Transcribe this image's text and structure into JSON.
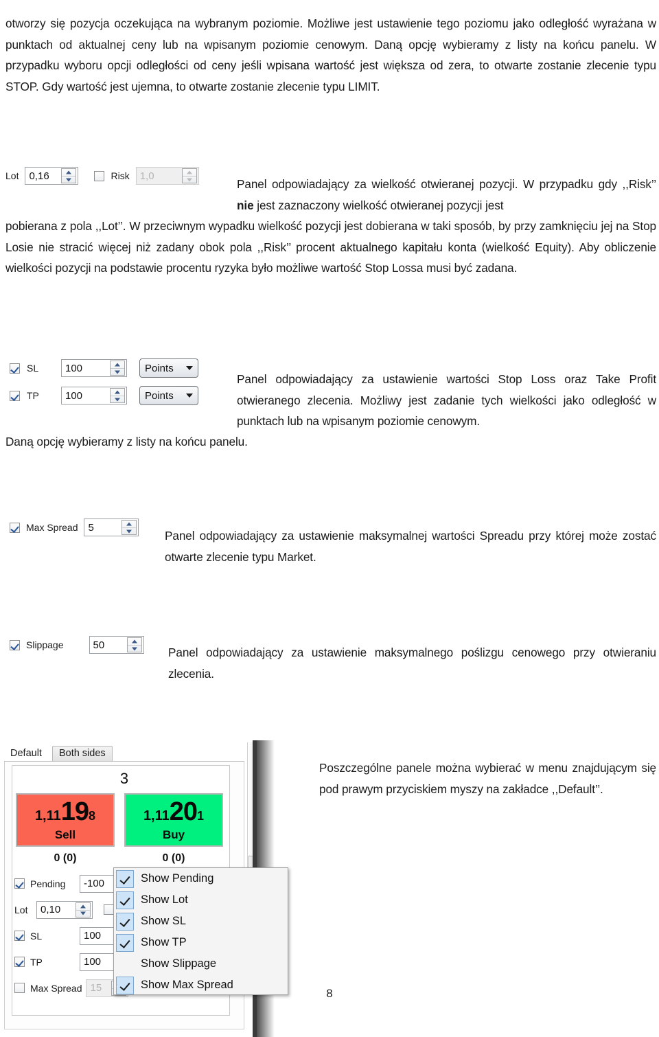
{
  "document": {
    "page_number": "8",
    "paragraphs": {
      "intro": "otworzy się pozycja oczekująca na wybranym poziomie. Możliwe jest ustawienie tego poziomu jako odległość wyrażana w punktach od aktualnej ceny lub na wpisanym poziomie cenowym.  Daną opcję wybieramy z listy na końcu panelu. W przypadku  wyboru opcji odległości od ceny jeśli wpisana wartość jest większa od zera, to otwarte zostanie zlecenie typu STOP. Gdy wartość jest ujemna, to otwarte zostanie zlecenie typu LIMIT.",
      "lot_part1_a": "Panel odpowiadający za wielkość otwieranej pozycji. W przypadku gdy ,,Risk’’ ",
      "lot_part1_bold": "nie",
      "lot_part1_b": " jest zaznaczony wielkość otwieranej   pozycji jest",
      "lot_part2": "pobierana z pola ,,Lot’’. W przeciwnym wypadku  wielkość pozycji jest dobierana w taki sposób, by przy zamknięciu jej na Stop Losie nie stracić więcej niż zadany obok pola ,,Risk’’ procent aktualnego kapitału konta (wielkość Equity). Aby obliczenie wielkości pozycji na podstawie procentu ryzyka było możliwe wartość Stop Lossa musi być zadana.",
      "sltp_part1": "Panel odpowiadający za ustawienie wartości Stop Loss oraz Take Profit otwieranego zlecenia. Możliwy jest zadanie tych wielkości jako odległość w punktach lub na wpisanym poziomie cenowym.",
      "sltp_part2": "Daną opcję wybieramy z listy na końcu panelu.",
      "max_spread": "Panel odpowiadający za ustawienie maksymalnej wartości Spreadu przy której może zostać otwarte zlecenie typu Market.",
      "slippage": " Panel odpowiadający za ustawienie maksymalnego poślizgu cenowego przy otwieraniu zlecenia.",
      "panel_menu": "Poszczególne panele można wybierać w menu znajdującym się pod prawym przyciskiem myszy na zakładce ,,Default’’."
    }
  },
  "widget_lot": {
    "lot_label": "Lot",
    "lot_value": "0,16",
    "risk_label": "Risk",
    "risk_value": "1,0",
    "risk_checked": false
  },
  "widget_sltp": {
    "rows": [
      {
        "label": "SL",
        "checked": true,
        "value": "100",
        "unit": "Points"
      },
      {
        "label": "TP",
        "checked": true,
        "value": "100",
        "unit": "Points"
      }
    ]
  },
  "widget_max_spread": {
    "label": "Max Spread",
    "checked": true,
    "value": "5"
  },
  "widget_slippage": {
    "label": "Slippage",
    "checked": true,
    "value": "50"
  },
  "widget_panel": {
    "tabs": [
      {
        "label": "Default",
        "active": true
      },
      {
        "label": "Both sides",
        "active": false
      }
    ],
    "spread": "3",
    "quotes": [
      {
        "side": "Sell",
        "pre": "1,11",
        "big": "19",
        "post": "8",
        "count": "0 (0)",
        "color": "#FA6450"
      },
      {
        "side": "Buy",
        "pre": "1,11",
        "big": "20",
        "post": "1",
        "count": "0 (0)",
        "color": "#00F080"
      }
    ],
    "form": {
      "pending": {
        "label": "Pending",
        "checked": true,
        "value": "-100"
      },
      "lot": {
        "label": "Lot",
        "value": "0,10",
        "risk_checked": false
      },
      "sl": {
        "label": "SL",
        "checked": true,
        "value": "100"
      },
      "tp": {
        "label": "TP",
        "checked": true,
        "value": "100"
      },
      "max_spread": {
        "label": "Max Spread",
        "checked": false,
        "value": "15"
      }
    },
    "context_menu": [
      {
        "label": "Show Pending",
        "checked": true
      },
      {
        "label": "Show Lot",
        "checked": true
      },
      {
        "label": "Show SL",
        "checked": true
      },
      {
        "label": "Show TP",
        "checked": true
      },
      {
        "label": "Show Slippage",
        "checked": false
      },
      {
        "label": "Show Max Spread",
        "checked": true
      }
    ]
  }
}
